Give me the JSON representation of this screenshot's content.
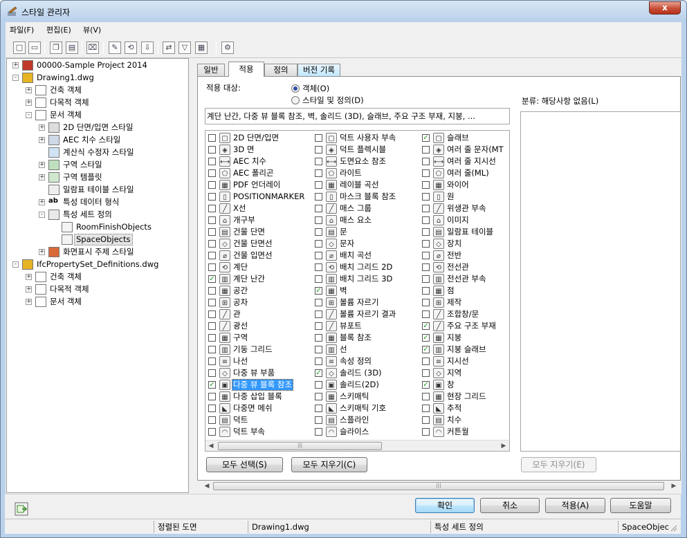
{
  "window": {
    "title": "스타일 관리자",
    "close": "x"
  },
  "menu": [
    "파일(F)",
    "편집(E)",
    "뷰(V)"
  ],
  "toolbar_icons": [
    "new-icon",
    "open-icon",
    "copy-icon",
    "paste-icon",
    "purge-icon",
    "edit-icon",
    "sync-icon",
    "import-icon",
    "compare-icon",
    "filter-icon",
    "view-icon",
    "tools-icon"
  ],
  "tree": [
    {
      "label": "00000-Sample Project 2014",
      "depth": 0,
      "exp": "+",
      "icon": "project-icon"
    },
    {
      "label": "Drawing1.dwg",
      "depth": 0,
      "exp": "-",
      "icon": "dwg-icon"
    },
    {
      "label": "건축 객체",
      "depth": 1,
      "exp": "+",
      "icon": "folder-icon"
    },
    {
      "label": "다목적 객체",
      "depth": 1,
      "exp": "+",
      "icon": "folder-icon"
    },
    {
      "label": "문서 객체",
      "depth": 1,
      "exp": "-",
      "icon": "folder-icon"
    },
    {
      "label": "2D 단면/입면 스타일",
      "depth": 2,
      "exp": "+",
      "icon": "section-icon"
    },
    {
      "label": "AEC 치수 스타일",
      "depth": 2,
      "exp": "+",
      "icon": "dimension-icon"
    },
    {
      "label": "계산식 수정자 스타일",
      "depth": 2,
      "exp": "",
      "icon": "calc-icon"
    },
    {
      "label": "구역 스타일",
      "depth": 2,
      "exp": "+",
      "icon": "zone-icon"
    },
    {
      "label": "구역 템플릿",
      "depth": 2,
      "exp": "+",
      "icon": "zone-template-icon"
    },
    {
      "label": "일람표 테이블 스타일",
      "depth": 2,
      "exp": "",
      "icon": "table-icon"
    },
    {
      "label": "특성 데이터 형식",
      "depth": 2,
      "exp": "+",
      "icon": "ab-icon"
    },
    {
      "label": "특성 세트 정의",
      "depth": 2,
      "exp": "-",
      "icon": "propset-icon"
    },
    {
      "label": "RoomFinishObjects",
      "depth": 3,
      "exp": "",
      "icon": "propset-item-icon"
    },
    {
      "label": "SpaceObjects",
      "depth": 3,
      "exp": "",
      "icon": "propset-item-icon",
      "selected": true
    },
    {
      "label": "화면표시 주제 스타일",
      "depth": 2,
      "exp": "+",
      "icon": "theme-icon"
    },
    {
      "label": "IfcPropertySet_Definitions.dwg",
      "depth": 0,
      "exp": "-",
      "icon": "dwg-icon"
    },
    {
      "label": "건축 객체",
      "depth": 1,
      "exp": "+",
      "icon": "folder-icon"
    },
    {
      "label": "다목적 객체",
      "depth": 1,
      "exp": "+",
      "icon": "folder-icon"
    },
    {
      "label": "문서 객체",
      "depth": 1,
      "exp": "+",
      "icon": "folder-icon"
    }
  ],
  "tabs": [
    "일반",
    "적용",
    "정의",
    "버전 기록"
  ],
  "applies": {
    "label": "적용 대상:",
    "radio1": "객체(O)",
    "radio2": "스타일 및 정의(D)",
    "summary": "계단 난간, 다중 뷰 블록 참조, 벽, 솔리드 (3D), 슬래브, 주요 구조 부재, 지붕, ..."
  },
  "classification": "분류: 해당사항 없음(L)",
  "objects": [
    [
      {
        "label": "2D 단면/입면",
        "checked": false
      },
      {
        "label": "3D 면",
        "checked": false
      },
      {
        "label": "AEC 치수",
        "checked": false
      },
      {
        "label": "AEC 폴리곤",
        "checked": false
      },
      {
        "label": "PDF 언더레이",
        "checked": false
      },
      {
        "label": "POSITIONMARKER",
        "checked": false
      },
      {
        "label": "X선",
        "checked": false
      },
      {
        "label": "개구부",
        "checked": false
      },
      {
        "label": "건물 단면",
        "checked": false
      },
      {
        "label": "건물 단면선",
        "checked": false
      },
      {
        "label": "건물 입면선",
        "checked": false
      },
      {
        "label": "계단",
        "checked": false
      },
      {
        "label": "계단 난간",
        "checked": true
      },
      {
        "label": "공간",
        "checked": false
      },
      {
        "label": "공차",
        "checked": false
      },
      {
        "label": "관",
        "checked": false
      },
      {
        "label": "광선",
        "checked": false
      },
      {
        "label": "구역",
        "checked": false
      },
      {
        "label": "기둥 그리드",
        "checked": false
      },
      {
        "label": "나선",
        "checked": false
      },
      {
        "label": "다중 뷰 부품",
        "checked": false
      },
      {
        "label": "다중 뷰 블록 참조",
        "checked": true,
        "selected": true
      },
      {
        "label": "다중 삽입 블록",
        "checked": false
      },
      {
        "label": "다중면 메쉬",
        "checked": false
      },
      {
        "label": "덕트",
        "checked": false
      },
      {
        "label": "덕트 부속",
        "checked": false
      }
    ],
    [
      {
        "label": "덕트 사용자 부속",
        "checked": false
      },
      {
        "label": "덕트 플렉시블",
        "checked": false
      },
      {
        "label": "도면요소 참조",
        "checked": false
      },
      {
        "label": "라이트",
        "checked": false
      },
      {
        "label": "레이블 곡선",
        "checked": false
      },
      {
        "label": "마스크 블록 참조",
        "checked": false
      },
      {
        "label": "매스 그룹",
        "checked": false
      },
      {
        "label": "매스 요소",
        "checked": false
      },
      {
        "label": "문",
        "checked": false
      },
      {
        "label": "문자",
        "checked": false
      },
      {
        "label": "배치 곡선",
        "checked": false
      },
      {
        "label": "배치 그리드 2D",
        "checked": false
      },
      {
        "label": "배치 그리드 3D",
        "checked": false
      },
      {
        "label": "벽",
        "checked": true
      },
      {
        "label": "볼륨 자르기",
        "checked": false
      },
      {
        "label": "볼륨 자르기 결과",
        "checked": false
      },
      {
        "label": "뷰포트",
        "checked": false
      },
      {
        "label": "블록 참조",
        "checked": false
      },
      {
        "label": "선",
        "checked": false
      },
      {
        "label": "속성 정의",
        "checked": false
      },
      {
        "label": "솔리드 (3D)",
        "checked": true
      },
      {
        "label": "솔리드(2D)",
        "checked": false
      },
      {
        "label": "스키매틱",
        "checked": false
      },
      {
        "label": "스키매틱 기호",
        "checked": false
      },
      {
        "label": "스플라인",
        "checked": false
      },
      {
        "label": "슬라이스",
        "checked": false
      }
    ],
    [
      {
        "label": "슬래브",
        "checked": true
      },
      {
        "label": "여러 줄 문자(MT",
        "checked": false
      },
      {
        "label": "여러 줄 지시선",
        "checked": false
      },
      {
        "label": "여러 줄(ML)",
        "checked": false
      },
      {
        "label": "와이어",
        "checked": false
      },
      {
        "label": "원",
        "checked": false
      },
      {
        "label": "위생관 부속",
        "checked": false
      },
      {
        "label": "이미지",
        "checked": false
      },
      {
        "label": "일람표 테이블",
        "checked": false
      },
      {
        "label": "장치",
        "checked": false
      },
      {
        "label": "전반",
        "checked": false
      },
      {
        "label": "전선관",
        "checked": false
      },
      {
        "label": "전선관 부속",
        "checked": false
      },
      {
        "label": "점",
        "checked": false
      },
      {
        "label": "제작",
        "checked": false
      },
      {
        "label": "조합창/문",
        "checked": false
      },
      {
        "label": "주요 구조 부재",
        "checked": true
      },
      {
        "label": "지붕",
        "checked": true
      },
      {
        "label": "지붕 슬래브",
        "checked": true
      },
      {
        "label": "지시선",
        "checked": false
      },
      {
        "label": "지역",
        "checked": false
      },
      {
        "label": "창",
        "checked": true
      },
      {
        "label": "현장 그리드",
        "checked": false
      },
      {
        "label": "추적",
        "checked": false
      },
      {
        "label": "치수",
        "checked": false
      },
      {
        "label": "커튼월",
        "checked": false
      }
    ]
  ],
  "buttons": {
    "select_all": "모두 선택(S)",
    "clear_all": "모두 지우기(C)",
    "clear_all_e": "모두 지우기(E)",
    "ok": "확인",
    "cancel": "취소",
    "apply": "적용(A)",
    "help": "도움말"
  },
  "status": [
    "정렬된 도면",
    "Drawing1.dwg",
    "특성 세트 정의",
    "SpaceObjec"
  ]
}
